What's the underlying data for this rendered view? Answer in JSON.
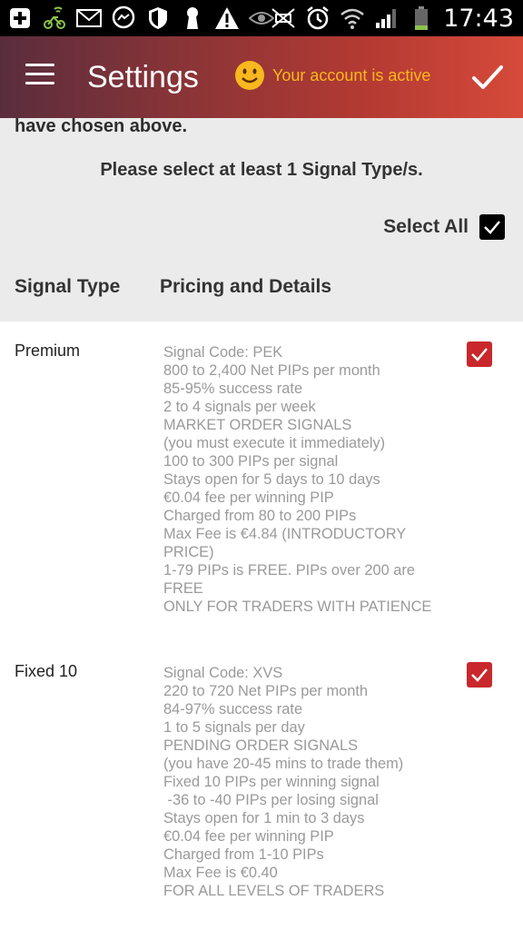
{
  "status_bar": {
    "time": "17:43",
    "icons_left": [
      "add-icon",
      "bike-icon",
      "mail-icon",
      "messenger-icon",
      "shield-icon",
      "keyhole-icon",
      "warning-icon",
      "eye-icon"
    ],
    "icons_right": [
      "no-signal-icon",
      "alarm-icon",
      "wifi-icon",
      "signal-bars-icon",
      "battery-icon"
    ]
  },
  "app_bar": {
    "title": "Settings",
    "status": "Your account is active",
    "status_color": "#f8b81e"
  },
  "content": {
    "cut_off_text": "have chosen above.",
    "instruction": "Please select at least 1 Signal Type/s.",
    "select_all_label": "Select All",
    "select_all_checked": true,
    "column_headers": {
      "type": "Signal Type",
      "details": "Pricing and Details"
    },
    "signals": [
      {
        "type": "Premium",
        "checked": true,
        "details": [
          "Signal Code: PEK",
          "800 to 2,400 Net PIPs per month",
          "85-95% success rate",
          "2 to 4 signals per week",
          "MARKET ORDER SIGNALS",
          "(you must execute it immediately)",
          "100 to 300 PIPs per signal",
          "Stays open for 5 days to 10 days",
          "€0.04 fee per winning PIP",
          "Charged from 80 to 200 PIPs",
          "Max Fee is €4.84 (INTRODUCTORY",
          "PRICE)",
          "1-79 PIPs is FREE. PIPs over 200 are",
          "FREE",
          "ONLY FOR TRADERS WITH PATIENCE"
        ]
      },
      {
        "type": "Fixed 10",
        "checked": true,
        "details": [
          "Signal Code: XVS",
          "220 to 720 Net PIPs per month",
          "84-97% success rate",
          "1 to 5 signals per day",
          "PENDING ORDER SIGNALS",
          "(you have 20-45 mins to trade them)",
          "Fixed 10 PIPs per winning signal",
          " -36 to -40 PIPs per losing signal",
          "Stays open for 1 min to 3 days",
          "€0.04 fee per winning PIP",
          "Charged from 1-10 PIPs",
          "Max Fee is €0.40",
          "FOR ALL LEVELS OF TRADERS"
        ]
      }
    ]
  },
  "colors": {
    "checkbox_red": "#c8282b",
    "detail_text": "#9a9a9a"
  }
}
